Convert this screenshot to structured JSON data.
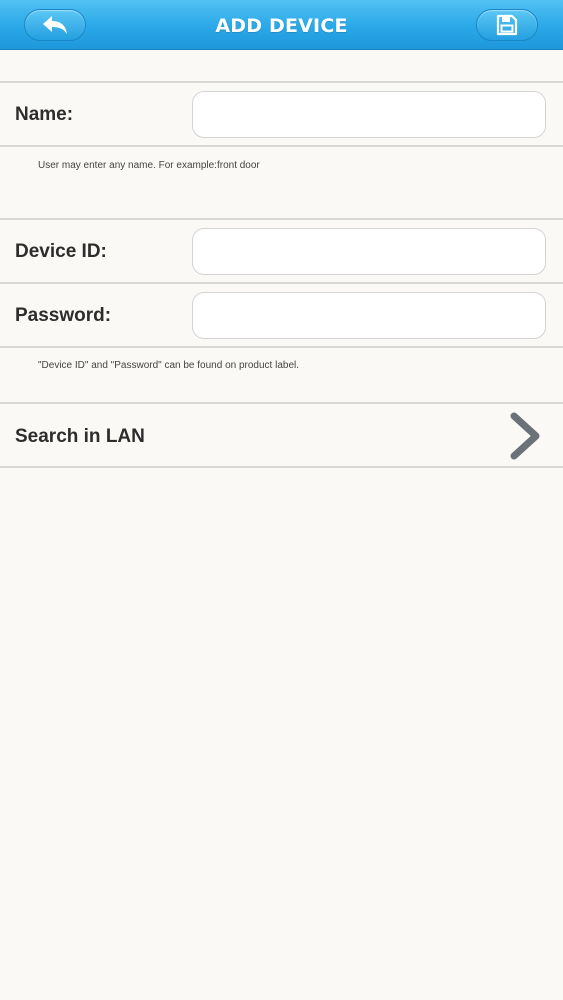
{
  "header": {
    "title": "ADD DEVICE",
    "back_icon": "back-arrow-icon",
    "save_icon": "floppy-save-icon",
    "color": "#2aa8e8"
  },
  "form": {
    "name": {
      "label": "Name:",
      "value": "",
      "hint": "User may enter any name. For example:front door"
    },
    "device_id": {
      "label": "Device ID:",
      "value": ""
    },
    "password": {
      "label": "Password:",
      "value": "",
      "hint": "\"Device ID\" and \"Password\" can be found on product label."
    }
  },
  "search_lan": {
    "label": "Search in LAN",
    "icon": "chevron-right-icon"
  }
}
